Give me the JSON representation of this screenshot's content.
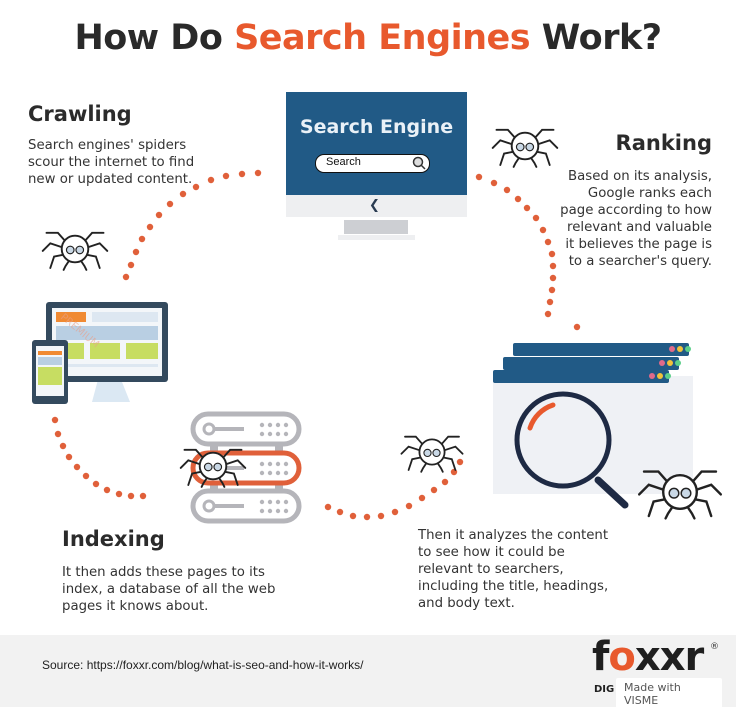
{
  "title": {
    "prefix": "How Do ",
    "accent": "Search Engines",
    "suffix": " Work?",
    "accent_color": "#e8592d"
  },
  "steps": {
    "crawling": {
      "heading": "Crawling",
      "text": "Search engines' spiders scour the internet to find new or updated content."
    },
    "ranking": {
      "heading": "Ranking",
      "text": "Based on its analysis, Google ranks each page according to how relevant and valuable it believes the page is to a searcher's query."
    },
    "indexing": {
      "heading": "Indexing",
      "text": "It then adds these pages to its index, a database of all the web pages it knows about."
    },
    "analyzing": {
      "text": "Then it analyzes the content to see how it could be relevant to searchers, including the title, headings, and body text."
    }
  },
  "search_engine_graphic": {
    "title": "Search Engine",
    "search_label": "Search",
    "screen_color": "#215a86",
    "back_glyph": "❮"
  },
  "icons": {
    "spider": "spider-icon",
    "monitor": "desktop-mobile-icon",
    "server": "server-rack-icon",
    "magnifier": "magnifying-glass-icon",
    "browser_windows": "browser-windows-icon"
  },
  "colors": {
    "dots": "#e0603a",
    "dark_navy": "#1e2a44",
    "window_bar": "#215a86",
    "server_gray": "#b5b5ba"
  },
  "watermark": {
    "text": "PREMIUM"
  },
  "footer": {
    "source": "Source: https://foxxr.com/blog/what-is-seo-and-how-it-works/",
    "logo_f": "f",
    "logo_o": "o",
    "logo_rest": "xxr",
    "logo_reg": "®",
    "logo_sub": "DIG",
    "made_with": "Made with VISME"
  }
}
